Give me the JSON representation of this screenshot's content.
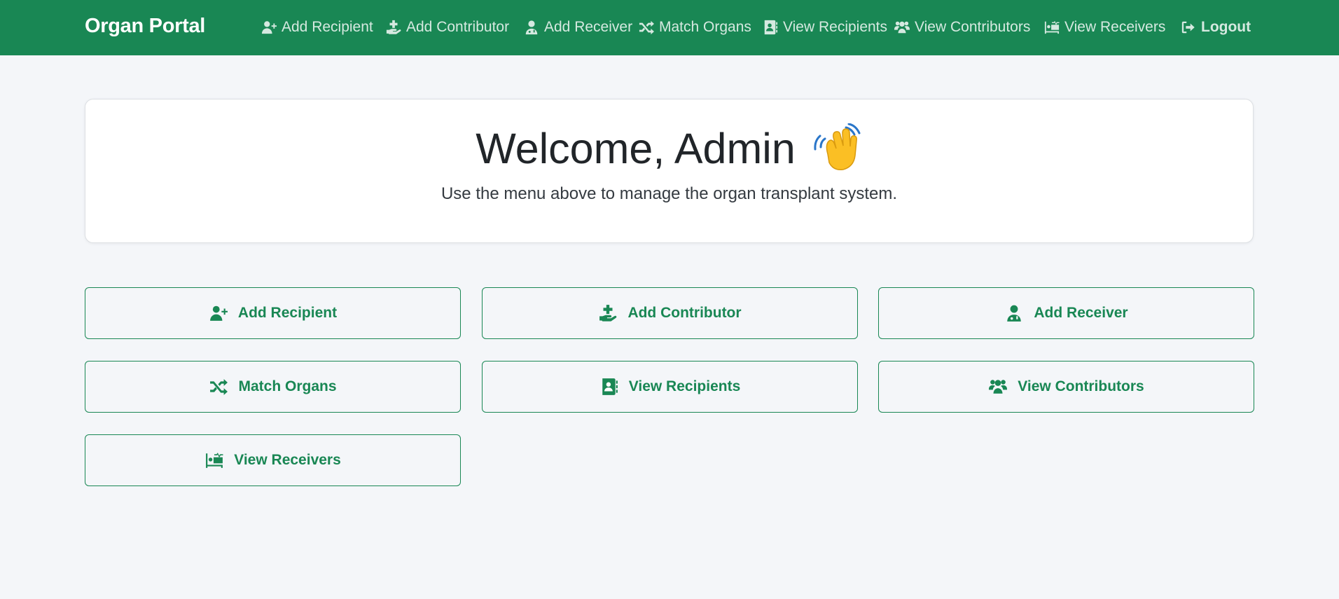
{
  "navbar": {
    "brand": "Organ Portal",
    "items": [
      {
        "label": "Add Recipient",
        "icon": "user-plus-icon"
      },
      {
        "label": "Add Contributor",
        "icon": "hand-holding-medical-icon"
      },
      {
        "label": "Add Receiver",
        "icon": "user-doctor-icon"
      },
      {
        "label": "Match Organs",
        "icon": "shuffle-icon"
      },
      {
        "label": "View Recipients",
        "icon": "address-book-icon"
      },
      {
        "label": "View Contributors",
        "icon": "users-icon"
      },
      {
        "label": "View Receivers",
        "icon": "bed-pulse-icon"
      }
    ],
    "logout": {
      "label": "Logout",
      "icon": "logout-icon"
    }
  },
  "welcome": {
    "title": "Welcome, Admin",
    "emoji": "waving-hand-icon",
    "subtitle": "Use the menu above to manage the organ transplant system."
  },
  "actions": [
    {
      "label": "Add Recipient",
      "icon": "user-plus-icon"
    },
    {
      "label": "Add Contributor",
      "icon": "hand-holding-medical-icon"
    },
    {
      "label": "Add Receiver",
      "icon": "user-doctor-icon"
    },
    {
      "label": "Match Organs",
      "icon": "shuffle-icon"
    },
    {
      "label": "View Recipients",
      "icon": "address-book-icon"
    },
    {
      "label": "View Contributors",
      "icon": "users-icon"
    },
    {
      "label": "View Receivers",
      "icon": "bed-pulse-icon"
    }
  ],
  "colors": {
    "primary": "#198754",
    "background": "#f4f6f9",
    "card": "#ffffff",
    "text": "#212529"
  }
}
